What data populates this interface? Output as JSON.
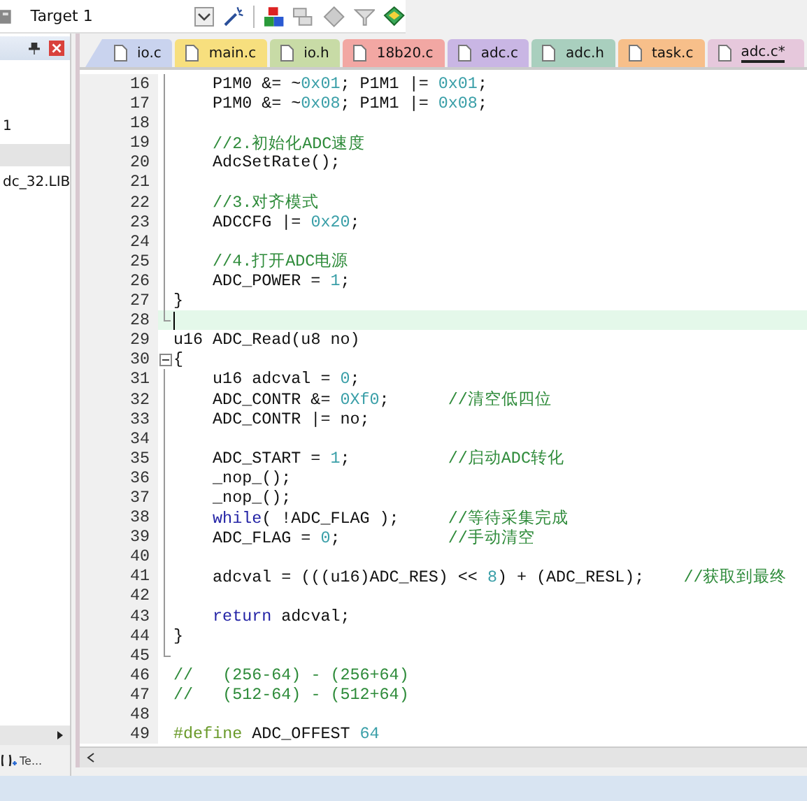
{
  "toolbar": {
    "target": "Target 1"
  },
  "project_panel": {
    "items": [
      {
        "label": "1",
        "selected": false
      },
      {
        "selected": true
      },
      {
        "label": "dc_32.LIB",
        "selected": false
      }
    ],
    "bottom_tab": "Te..."
  },
  "tabs": [
    {
      "label": "io.c",
      "color": "#c9d3ee",
      "selected": false
    },
    {
      "label": "main.c",
      "color": "#f7df7e",
      "selected": false
    },
    {
      "label": "io.h",
      "color": "#c8dba6",
      "selected": false
    },
    {
      "label": "18b20.c",
      "color": "#f2a7a3",
      "selected": false
    },
    {
      "label": "adc.c",
      "color": "#c9b6e4",
      "selected": false
    },
    {
      "label": "adc.h",
      "color": "#a9cfbe",
      "selected": false
    },
    {
      "label": "task.c",
      "color": "#f7bf8a",
      "selected": false
    },
    {
      "label": "adc.c*",
      "color": "#e6c8dc",
      "selected": true
    }
  ],
  "lines": [
    {
      "no": "16",
      "kind": "block",
      "current": false,
      "indented": true,
      "tokens": [
        {
          "kind": "plain",
          "text": "P1M0 &= ~"
        },
        {
          "kind": "number",
          "text": "0x01"
        },
        {
          "kind": "plain",
          "text": "; P1M1 |= "
        },
        {
          "kind": "number",
          "text": "0x01"
        },
        {
          "kind": "plain",
          "text": ";"
        }
      ]
    },
    {
      "no": "17",
      "kind": "block",
      "current": false,
      "indented": true,
      "tokens": [
        {
          "kind": "plain",
          "text": "P1M0 &= ~"
        },
        {
          "kind": "number",
          "text": "0x08"
        },
        {
          "kind": "plain",
          "text": "; P1M1 |= "
        },
        {
          "kind": "number",
          "text": "0x08"
        },
        {
          "kind": "plain",
          "text": ";"
        }
      ]
    },
    {
      "no": "18",
      "kind": "block",
      "current": false
    },
    {
      "no": "19",
      "kind": "block",
      "current": false,
      "indented": true,
      "tokens": [
        {
          "kind": "comment",
          "text": "//2.初始化ADC速度"
        }
      ]
    },
    {
      "no": "20",
      "kind": "block",
      "current": false,
      "indented": true,
      "tokens": [
        {
          "kind": "plain",
          "text": "AdcSetRate();"
        }
      ]
    },
    {
      "no": "21",
      "kind": "block",
      "current": false
    },
    {
      "no": "22",
      "kind": "block",
      "current": false,
      "indented": true,
      "tokens": [
        {
          "kind": "comment",
          "text": "//3.对齐模式"
        }
      ]
    },
    {
      "no": "23",
      "kind": "block",
      "current": false,
      "indented": true,
      "tokens": [
        {
          "kind": "plain",
          "text": "ADCCFG |= "
        },
        {
          "kind": "number",
          "text": "0x20"
        },
        {
          "kind": "plain",
          "text": ";"
        }
      ]
    },
    {
      "no": "24",
      "kind": "block",
      "current": false
    },
    {
      "no": "25",
      "kind": "block",
      "current": false,
      "indented": true,
      "tokens": [
        {
          "kind": "comment",
          "text": "//4.打开ADC电源"
        }
      ]
    },
    {
      "no": "26",
      "kind": "block",
      "current": false,
      "indented": true,
      "tokens": [
        {
          "kind": "plain",
          "text": "ADC_POWER = "
        },
        {
          "kind": "number",
          "text": "1"
        },
        {
          "kind": "plain",
          "text": ";"
        }
      ]
    },
    {
      "no": "27",
      "kind": "block",
      "current": false,
      "indented": false,
      "tokens": [
        {
          "kind": "plain",
          "text": "}"
        }
      ]
    },
    {
      "no": "28",
      "kind": "block-end",
      "current": true
    },
    {
      "no": "29",
      "kind": "plain",
      "current": false,
      "indented": false,
      "tokens": [
        {
          "kind": "plain",
          "text": "u16 ADC_Read(u8 no)"
        }
      ]
    },
    {
      "no": "30",
      "kind": "block-start",
      "current": false,
      "indented": false,
      "tokens": [
        {
          "kind": "plain",
          "text": "{"
        }
      ]
    },
    {
      "no": "31",
      "kind": "block",
      "current": false,
      "indented": true,
      "tokens": [
        {
          "kind": "plain",
          "text": "u16 adcval = "
        },
        {
          "kind": "number",
          "text": "0"
        },
        {
          "kind": "plain",
          "text": ";"
        }
      ]
    },
    {
      "no": "32",
      "kind": "block",
      "current": false,
      "indented": true,
      "tokens": [
        {
          "kind": "plain",
          "text": "ADC_CONTR &= "
        },
        {
          "kind": "number",
          "text": "0Xf0"
        },
        {
          "kind": "plain",
          "text": ";      "
        },
        {
          "kind": "comment",
          "text": "//清空低四位"
        }
      ]
    },
    {
      "no": "33",
      "kind": "block",
      "current": false,
      "indented": true,
      "tokens": [
        {
          "kind": "plain",
          "text": "ADC_CONTR |= no;"
        }
      ]
    },
    {
      "no": "34",
      "kind": "block",
      "current": false
    },
    {
      "no": "35",
      "kind": "block",
      "current": false,
      "indented": true,
      "tokens": [
        {
          "kind": "plain",
          "text": "ADC_START = "
        },
        {
          "kind": "number",
          "text": "1"
        },
        {
          "kind": "plain",
          "text": ";          "
        },
        {
          "kind": "comment",
          "text": "//启动ADC转化"
        }
      ]
    },
    {
      "no": "36",
      "kind": "block",
      "current": false,
      "indented": true,
      "tokens": [
        {
          "kind": "plain",
          "text": "_nop_();"
        }
      ]
    },
    {
      "no": "37",
      "kind": "block",
      "current": false,
      "indented": true,
      "tokens": [
        {
          "kind": "plain",
          "text": "_nop_();"
        }
      ]
    },
    {
      "no": "38",
      "kind": "block",
      "current": false,
      "indented": true,
      "tokens": [
        {
          "kind": "keyword",
          "text": "while"
        },
        {
          "kind": "plain",
          "text": "( !ADC_FLAG );     "
        },
        {
          "kind": "comment",
          "text": "//等待采集完成"
        }
      ]
    },
    {
      "no": "39",
      "kind": "block",
      "current": false,
      "indented": true,
      "tokens": [
        {
          "kind": "plain",
          "text": "ADC_FLAG = "
        },
        {
          "kind": "number",
          "text": "0"
        },
        {
          "kind": "plain",
          "text": ";           "
        },
        {
          "kind": "comment",
          "text": "//手动清空"
        }
      ]
    },
    {
      "no": "40",
      "kind": "block",
      "current": false
    },
    {
      "no": "41",
      "kind": "block",
      "current": false,
      "indented": true,
      "tokens": [
        {
          "kind": "plain",
          "text": "adcval = (((u16)ADC_RES) << "
        },
        {
          "kind": "number",
          "text": "8"
        },
        {
          "kind": "plain",
          "text": ") + (ADC_RESL);    "
        },
        {
          "kind": "comment",
          "text": "//获取到最终"
        }
      ]
    },
    {
      "no": "42",
      "kind": "block",
      "current": false
    },
    {
      "no": "43",
      "kind": "block",
      "current": false,
      "indented": true,
      "tokens": [
        {
          "kind": "keyword",
          "text": "return"
        },
        {
          "kind": "plain",
          "text": " adcval;"
        }
      ]
    },
    {
      "no": "44",
      "kind": "block",
      "current": false,
      "indented": false,
      "tokens": [
        {
          "kind": "plain",
          "text": "}"
        }
      ]
    },
    {
      "no": "45",
      "kind": "block-end",
      "current": false
    },
    {
      "no": "46",
      "kind": "plain",
      "current": false,
      "indented": false,
      "tokens": [
        {
          "kind": "comment",
          "text": "//   (256-64) - (256+64)"
        }
      ]
    },
    {
      "no": "47",
      "kind": "plain",
      "current": false,
      "indented": false,
      "tokens": [
        {
          "kind": "comment",
          "text": "//   (512-64) - (512+64)"
        }
      ]
    },
    {
      "no": "48",
      "kind": "plain",
      "current": false
    },
    {
      "no": "49",
      "kind": "plain",
      "current": false,
      "indented": false,
      "tokens": [
        {
          "kind": "keyword2",
          "text": "#define"
        },
        {
          "kind": "plain",
          "text": " ADC_OFFEST "
        },
        {
          "kind": "number",
          "text": "64"
        }
      ]
    }
  ]
}
